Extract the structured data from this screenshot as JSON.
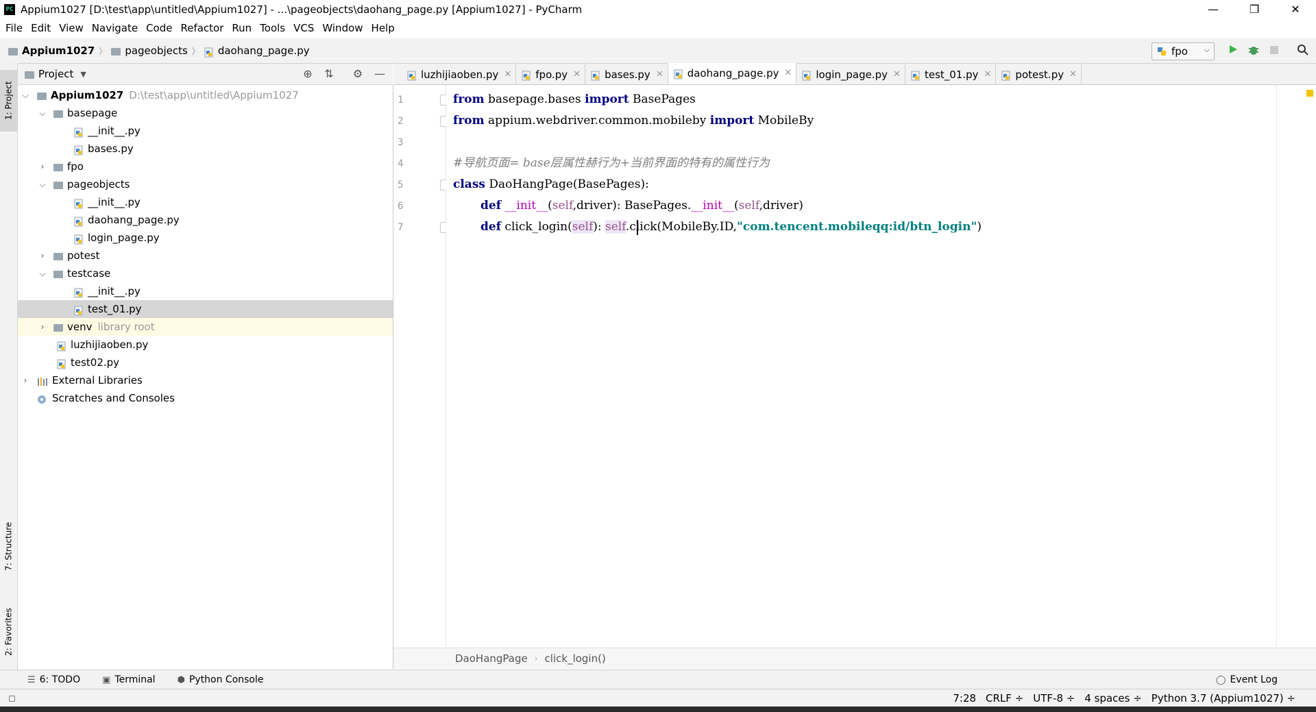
{
  "window": {
    "app_icon": "PC",
    "title": "Appium1027 [D:\\test\\app\\untitled\\Appium1027] - ...\\pageobjects\\daohang_page.py [Appium1027] - PyCharm",
    "minimize": "—",
    "maximize": "❐",
    "close": "✕"
  },
  "menu": [
    "File",
    "Edit",
    "View",
    "Navigate",
    "Code",
    "Refactor",
    "Run",
    "Tools",
    "VCS",
    "Window",
    "Help"
  ],
  "breadcrumbs": [
    "Appium1027",
    "pageobjects",
    "daohang_page.py"
  ],
  "run_config": "fpo",
  "left_strip": {
    "project": "1: Project",
    "structure": "7: Structure",
    "favorites": "2: Favorites"
  },
  "project_panel": {
    "title": "Project",
    "tree": [
      {
        "label": "Appium1027",
        "path": "D:\\test\\app\\untitled\\Appium1027",
        "bold": true
      },
      {
        "label": "basepage"
      },
      {
        "label": "__init__.py"
      },
      {
        "label": "bases.py"
      },
      {
        "label": "fpo"
      },
      {
        "label": "pageobjects"
      },
      {
        "label": "__init__.py"
      },
      {
        "label": "daohang_page.py"
      },
      {
        "label": "login_page.py"
      },
      {
        "label": "potest"
      },
      {
        "label": "testcase"
      },
      {
        "label": "__init__.py"
      },
      {
        "label": "test_01.py"
      },
      {
        "label": "venv",
        "note": "library root"
      },
      {
        "label": "luzhijiaoben.py"
      },
      {
        "label": "test02.py"
      },
      {
        "label": "External Libraries"
      },
      {
        "label": "Scratches and Consoles"
      }
    ]
  },
  "tabs": [
    "luzhijiaoben.py",
    "fpo.py",
    "bases.py",
    "daohang_page.py",
    "login_page.py",
    "test_01.py",
    "potest.py"
  ],
  "active_tab": "daohang_page.py",
  "editor": {
    "line_numbers": [
      "1",
      "2",
      "3",
      "4",
      "5",
      "6",
      "7"
    ],
    "code": {
      "l1": {
        "kw1": "from",
        "mod": " basepage.bases ",
        "kw2": "import",
        "name": " BasePages"
      },
      "l2": {
        "kw1": "from",
        "mod": " appium.webdriver.common.mobileby ",
        "kw2": "import",
        "name": " MobileBy"
      },
      "l4": {
        "comment": "#导航页面= base层属性赫行为+当前界面的特有的属性行为"
      },
      "l5": {
        "kw": "class",
        "rest": " DaoHangPage(BasePages):"
      },
      "l6": {
        "kw": "def",
        "fn": " __init__",
        "p1": "(",
        "self1": "self",
        "p2": ",driver): BasePages.",
        "fn2": "__init__",
        "p3": "(",
        "self2": "self",
        "p4": ",driver)"
      },
      "l7": {
        "kw": "def",
        "fn": " click_login(",
        "self1": "self",
        "p2": "): ",
        "self2": "self",
        "p3": ".click(MobileBy.ID,",
        "str": "\"com.tencent.mobileqq:id/btn_login\"",
        "p4": ")"
      }
    }
  },
  "editor_breadcrumb": [
    "DaoHangPage",
    "click_login()"
  ],
  "tool_windows": [
    "6: TODO",
    "Terminal",
    "Python Console"
  ],
  "event_log": "Event Log",
  "status": {
    "position": "7:28",
    "line_sep": "CRLF ÷",
    "encoding": "UTF-8 ÷",
    "indent": "4 spaces ÷",
    "interpreter": "Python 3.7 (Appium1027) ÷"
  },
  "colors": {
    "keyword": "#000080",
    "string": "#008080",
    "self": "#94558d",
    "comment": "#808080",
    "magic": "#b200b2",
    "selection": "#d6d6d6",
    "caret_row": "#fffae3"
  }
}
